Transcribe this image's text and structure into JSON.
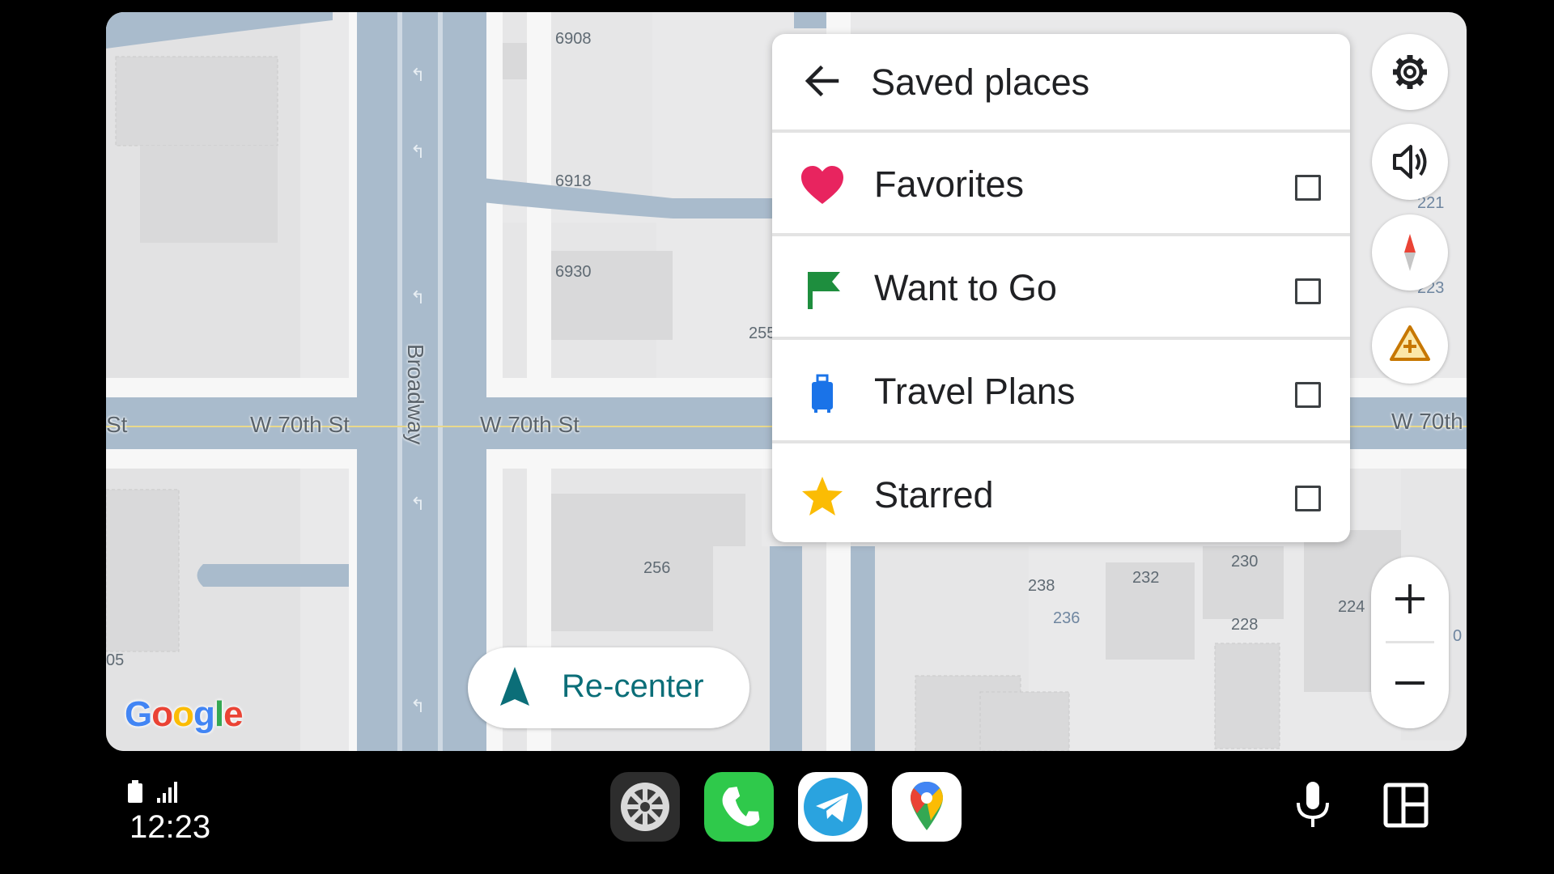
{
  "map": {
    "streets": {
      "w70th_left": "W 70th St",
      "w70th_mid": "W 70th St",
      "w70th_right": "W 70th",
      "st_left": "St",
      "broadway": "Broadway"
    },
    "numbers": [
      "6908",
      "6918",
      "6930",
      "255",
      "256",
      "238",
      "236",
      "232",
      "230",
      "228",
      "224",
      "221",
      "223",
      "05",
      "0"
    ],
    "logo": "Google"
  },
  "saved_places": {
    "title": "Saved places",
    "back_icon": "arrow-left-icon",
    "items": [
      {
        "label": "Favorites",
        "icon": "heart-icon",
        "color": "#e8245f",
        "checked": false
      },
      {
        "label": "Want to Go",
        "icon": "flag-icon",
        "color": "#1e8e3e",
        "checked": false
      },
      {
        "label": "Travel Plans",
        "icon": "suitcase-icon",
        "color": "#1a73e8",
        "checked": false
      },
      {
        "label": "Starred",
        "icon": "star-icon",
        "color": "#fbbc04",
        "checked": false
      }
    ]
  },
  "controls": {
    "settings_icon": "gear-icon",
    "sound_icon": "speaker-icon",
    "compass_icon": "compass-icon",
    "report_icon": "warning-plus-icon",
    "zoom_in": "+",
    "zoom_out": "−"
  },
  "recenter": {
    "label": "Re-center",
    "icon": "navigation-arrow-icon",
    "color": "#0b6e78"
  },
  "dock": {
    "time": "12:23",
    "apps": [
      "settings-app",
      "phone-app",
      "telegram-app",
      "maps-app"
    ],
    "mic_icon": "microphone-icon",
    "layout_icon": "layout-icon"
  }
}
